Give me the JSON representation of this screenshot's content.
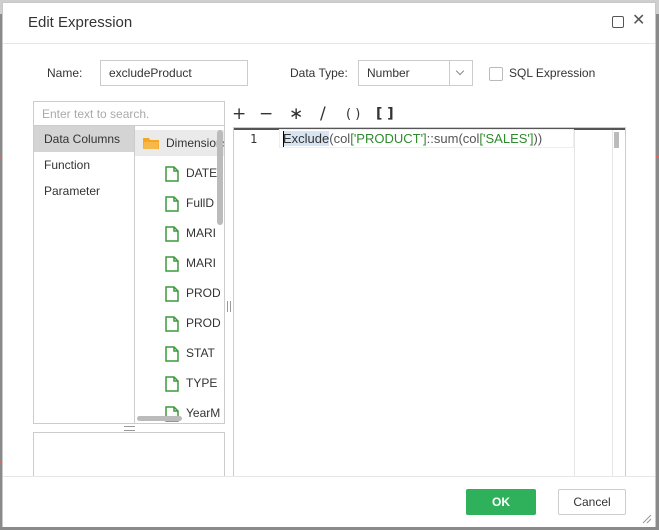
{
  "dialog": {
    "title": "Edit Expression",
    "name_label": "Name:",
    "name_value": "excludeProduct",
    "data_type_label": "Data Type:",
    "data_type_value": "Number",
    "sql_label": "SQL Expression",
    "sql_checked": false
  },
  "search": {
    "placeholder": "Enter text to search."
  },
  "categories": [
    {
      "label": "Data Columns",
      "active": true
    },
    {
      "label": "Function",
      "active": false
    },
    {
      "label": "Parameter",
      "active": false
    }
  ],
  "tree": {
    "folder": "Dimensions",
    "leaves": [
      "DATE",
      "FullD",
      "MARI",
      "MARI",
      "PROD",
      "PROD",
      "STAT",
      "TYPE",
      "YearM"
    ]
  },
  "operators": [
    "+",
    "−",
    "∗",
    "/",
    "( )",
    "[ ]"
  ],
  "editor": {
    "line_number": "1",
    "code_fn": "Exclude",
    "code_rest_1": "(col",
    "code_rest_2": "['PRODUCT']",
    "code_rest_3": "::sum(col",
    "code_rest_4": "['SALES']",
    "code_rest_5": "))"
  },
  "footer": {
    "ok": "OK",
    "cancel": "Cancel"
  },
  "colors": {
    "ok_green": "#2fb05a",
    "folder_orange": "#f5a623",
    "doc_green": "#3a9a3a",
    "code_green": "#2e8b2e"
  }
}
